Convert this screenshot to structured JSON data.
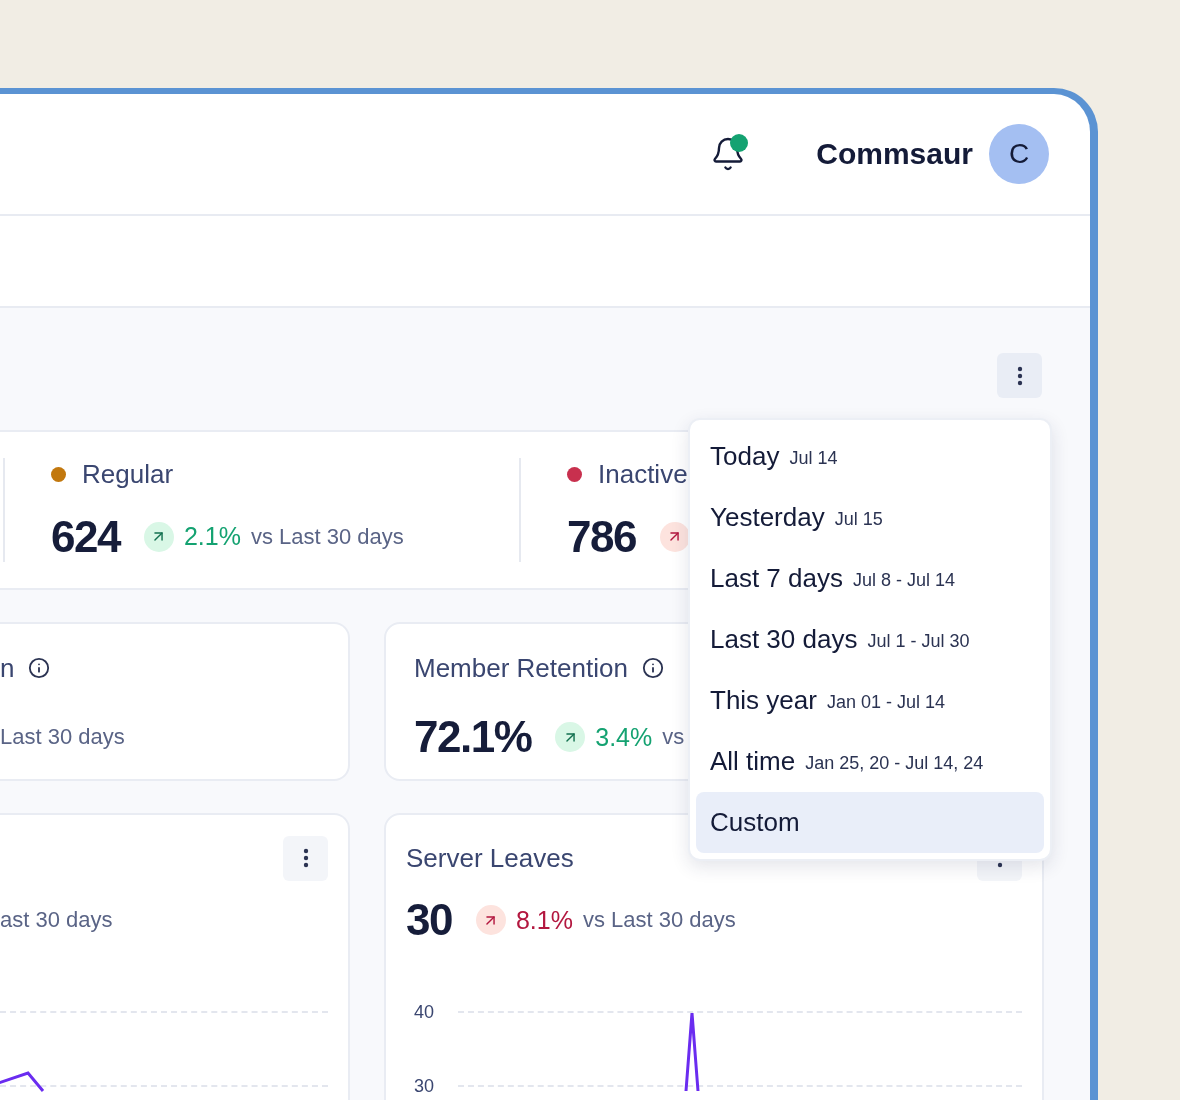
{
  "header": {
    "user_name": "Commsaur",
    "avatar_initial": "C",
    "notification_unread": true
  },
  "segments": [
    {
      "label": "Regular",
      "color": "#c2780e",
      "value": "624",
      "change": "2.1%",
      "positive": true,
      "comparison": "vs Last 30 days"
    },
    {
      "label": "Inactive",
      "color": "#c8304e",
      "value": "786",
      "positive": false
    }
  ],
  "metric_cards": [
    {
      "title": "n",
      "info": true,
      "comparison": "Last 30 days"
    },
    {
      "title": "Member Retention",
      "info": true,
      "value": "72.1%",
      "change": "3.4%",
      "positive": true,
      "comparison": "vs"
    }
  ],
  "chart_cards": [
    {
      "comparison": "ast 30 days"
    },
    {
      "title": "Server Leaves",
      "value": "30",
      "change": "8.1%",
      "positive": false,
      "comparison": "vs Last 30 days",
      "y_labels": [
        "40",
        "30"
      ]
    }
  ],
  "date_menu": [
    {
      "label": "Today",
      "range": "Jul 14",
      "selected": false
    },
    {
      "label": "Yesterday",
      "range": "Jul 15",
      "selected": false
    },
    {
      "label": "Last 7 days",
      "range": "Jul 8 - Jul 14",
      "selected": false
    },
    {
      "label": "Last 30 days",
      "range": "Jul 1 - Jul 30",
      "selected": false
    },
    {
      "label": "This year",
      "range": "Jan 01 - Jul 14",
      "selected": false
    },
    {
      "label": "All time",
      "range": "Jan 25, 20 - Jul 14, 24",
      "selected": false
    },
    {
      "label": "Custom",
      "selected": true
    }
  ]
}
